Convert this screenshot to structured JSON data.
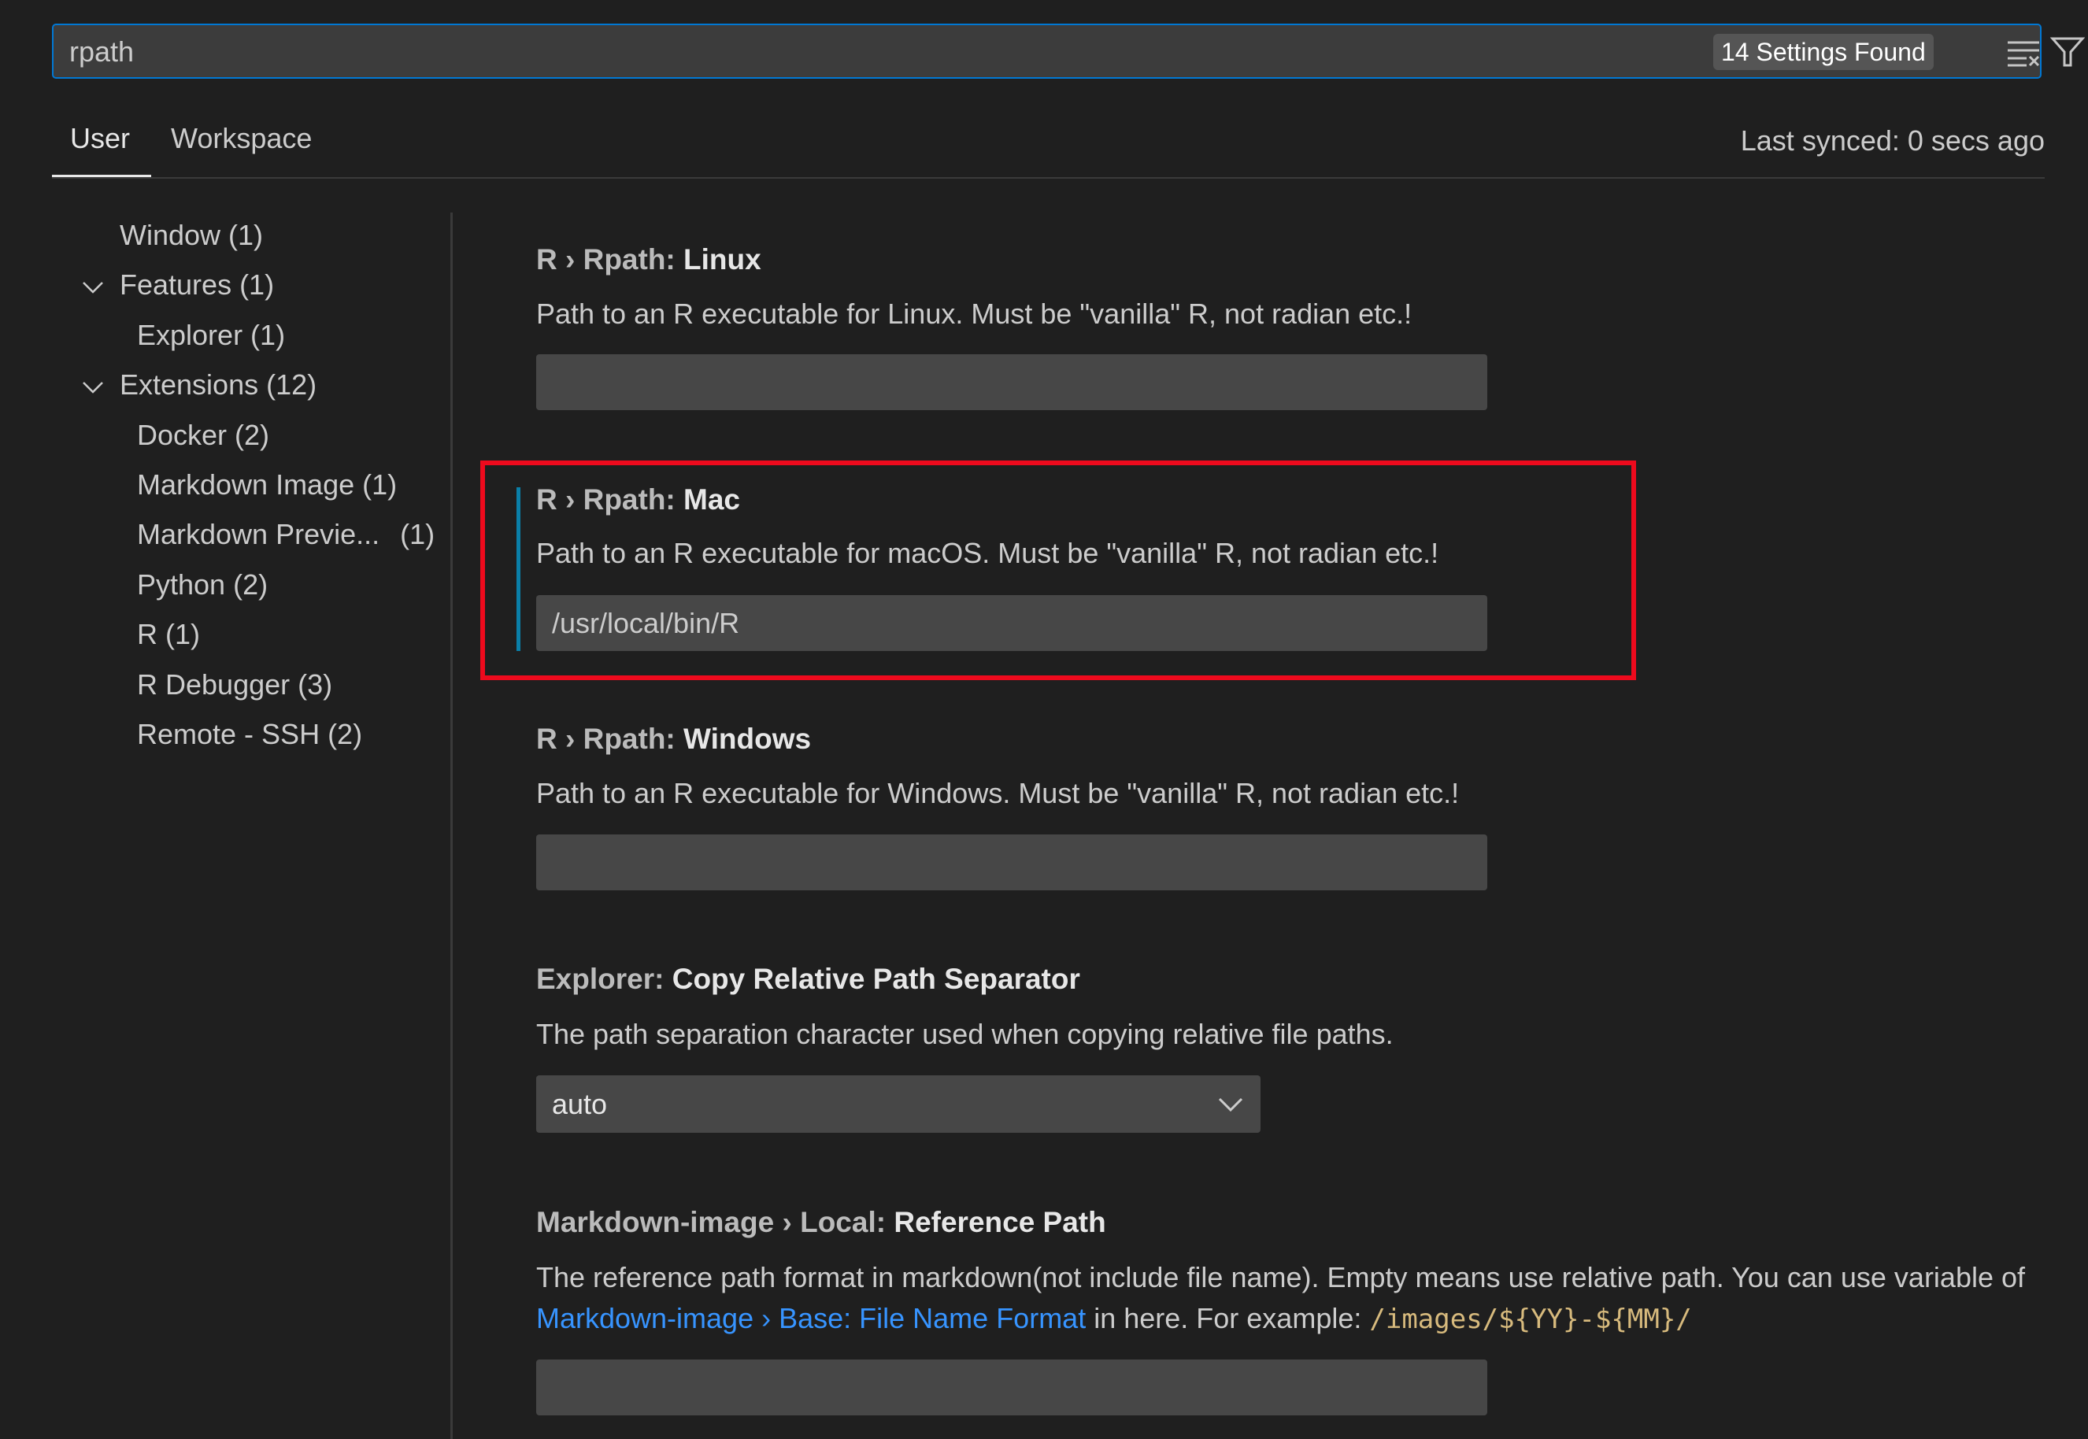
{
  "search": {
    "value": "rpath",
    "count": "14 Settings Found",
    "clear_icon": "clear-filter-icon",
    "filter_icon": "filter-icon",
    "accent": "#0078d4"
  },
  "tabs": [
    {
      "label": "User",
      "active": true
    },
    {
      "label": "Workspace",
      "active": false
    }
  ],
  "last_synced": "Last synced: 0 secs ago",
  "sidebar": {
    "items": [
      {
        "label": "Window (1)",
        "level": 0,
        "expanded": null
      },
      {
        "label": "Features (1)",
        "level": 0,
        "expanded": true
      },
      {
        "label": "Explorer (1)",
        "level": 1
      },
      {
        "label": "Extensions (12)",
        "level": 0,
        "expanded": true
      },
      {
        "label": "Docker (2)",
        "level": 1
      },
      {
        "label": "Markdown Image (1)",
        "level": 1
      },
      {
        "label": "Markdown Previe...",
        "count": "(1)",
        "level": 1
      },
      {
        "label": "Python (2)",
        "level": 1
      },
      {
        "label": "R (1)",
        "level": 1
      },
      {
        "label": "R Debugger (3)",
        "level": 1
      },
      {
        "label": "Remote - SSH (2)",
        "level": 1
      }
    ]
  },
  "settings": [
    {
      "category": "R › Rpath: ",
      "name": "Linux",
      "description": "Path to an R executable for Linux. Must be \"vanilla\" R, not radian etc.!",
      "value": ""
    },
    {
      "category": "R › Rpath: ",
      "name": "Mac",
      "description": "Path to an R executable for macOS. Must be \"vanilla\" R, not radian etc.!",
      "value": "/usr/local/bin/R",
      "highlighted": true
    },
    {
      "category": "R › Rpath: ",
      "name": "Windows",
      "description": "Path to an R executable for Windows. Must be \"vanilla\" R, not radian etc.!",
      "value": ""
    },
    {
      "category": "Explorer: ",
      "name": "Copy Relative Path Separator",
      "description": "The path separation character used when copying relative file paths.",
      "value": "auto"
    },
    {
      "category": "Markdown-image › Local: ",
      "name": "Reference Path",
      "description_before": "The reference path format in markdown(not include file name). Empty means use relative path. You can use variable of ",
      "description_link": "Markdown-image › Base: File Name Format",
      "description_mid": " in here. For example: ",
      "description_code": "/images/${YY}-${MM}/",
      "value": ""
    }
  ],
  "colors": {
    "highlight_box": "#ee0a1d",
    "modified_bar": "#0a7fa8",
    "link": "#3794ff",
    "code": "#d7ba7d"
  }
}
